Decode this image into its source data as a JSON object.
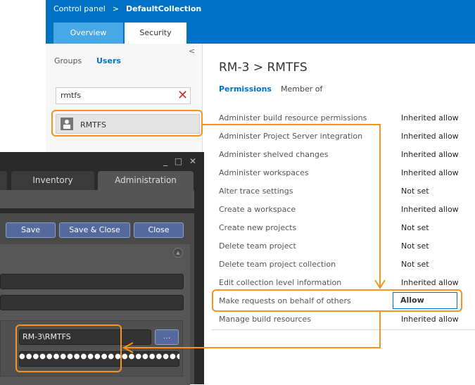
{
  "breadcrumb": {
    "root": "Control panel",
    "sep": ">",
    "current": "DefaultCollection"
  },
  "tabs": [
    "Overview",
    "Security"
  ],
  "left": {
    "groups": "Groups",
    "users": "Users",
    "search_value": "rmtfs",
    "result": "RMTFS",
    "collapse": "<"
  },
  "identity": {
    "title": "RM-3 > RMTFS",
    "tab_permissions": "Permissions",
    "tab_member_of": "Member of"
  },
  "permissions": [
    {
      "name": "Administer build resource permissions",
      "value": "Inherited allow"
    },
    {
      "name": "Administer Project Server integration",
      "value": "Inherited allow"
    },
    {
      "name": "Administer shelved changes",
      "value": "Inherited allow"
    },
    {
      "name": "Administer workspaces",
      "value": "Inherited allow"
    },
    {
      "name": "Alter trace settings",
      "value": "Not set"
    },
    {
      "name": "Create a workspace",
      "value": "Inherited allow"
    },
    {
      "name": "Create new projects",
      "value": "Not set"
    },
    {
      "name": "Delete team project",
      "value": "Not set"
    },
    {
      "name": "Delete team project collection",
      "value": "Not set"
    },
    {
      "name": "Edit collection level information",
      "value": "Inherited allow"
    },
    {
      "name": "Make requests on behalf of others",
      "value": "Allow"
    },
    {
      "name": "Manage build resources",
      "value": "Inherited allow"
    }
  ],
  "dialog": {
    "tabs": [
      "Inventory",
      "Administration"
    ],
    "save": "Save",
    "save_close": "Save & Close",
    "close": "Close",
    "username": "RM-3\\RMTFS",
    "password": "●●●●●●●●●●●●●●●●●●●●●●●●",
    "browse": "...",
    "window_controls": "_ □ ✕"
  },
  "colors": {
    "accent": "#0072c6",
    "highlight": "#f7931e"
  }
}
